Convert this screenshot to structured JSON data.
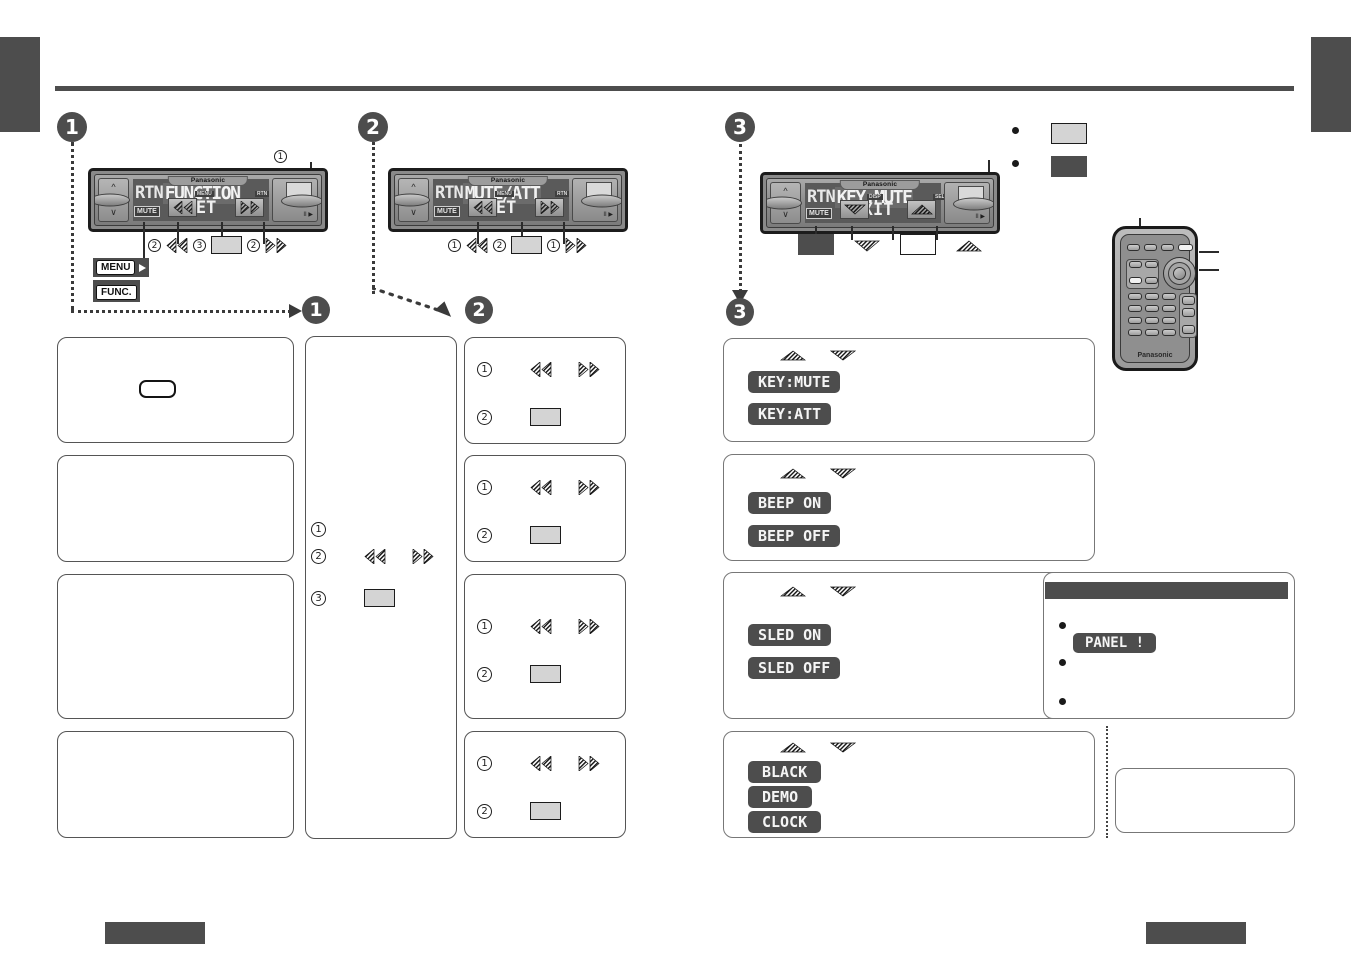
{
  "document": {
    "type": "car-audio-owners-manual-page",
    "title_rule": true
  },
  "edge_tabs": {
    "left": "",
    "right": ""
  },
  "footer": {
    "left_box": "",
    "right_box": ""
  },
  "steps": [
    {
      "number": "1"
    },
    {
      "number": "2"
    },
    {
      "number": "3"
    }
  ],
  "panel1": {
    "step_label": "1",
    "callout_top": "1",
    "stereo": {
      "brand": "Panasonic",
      "lcd_prefix": "RTN",
      "lcd_main": "FUNCTION",
      "lcd_bottom": "SET",
      "mute_badge": "MUTE",
      "tag_left": "MENU",
      "tag_right": "RTN",
      "play_pause": "II ▶"
    },
    "key_row": [
      {
        "num": "2",
        "icon": "chevron-left-hatched"
      },
      {
        "num": "3",
        "icon": "grey-key"
      },
      {
        "num": "2",
        "icon": "chevron-right-hatched"
      }
    ],
    "menu_label": "MENU",
    "func_label": "FUNC."
  },
  "panel2": {
    "step_label": "2",
    "stereo": {
      "brand": "Panasonic",
      "lcd_prefix": "RTN",
      "lcd_main": "MUTE/ATT",
      "lcd_bottom": "SET",
      "mute_badge": "MUTE",
      "tag_left": "MENU",
      "tag_right": "RTN",
      "play_pause": "II ▶"
    },
    "key_row": [
      {
        "num": "1",
        "icon": "chevron-left-hatched"
      },
      {
        "num": "2",
        "icon": "grey-key"
      },
      {
        "num": "1",
        "icon": "chevron-right-hatched"
      }
    ]
  },
  "panel3": {
    "step_label": "3",
    "stereo": {
      "brand": "Panasonic",
      "lcd_prefix": "RTN",
      "lcd_main": "KEY:MUTE",
      "lcd_bottom": "EXIT",
      "mute_badge": "MUTE",
      "tag_left": "DISP",
      "tag_right": "SEL",
      "play_pause": "II ▶"
    },
    "key_row": [
      {
        "icon": "dark-key"
      },
      {
        "icon": "triangle-down-hatched"
      },
      {
        "icon": "white-key"
      },
      {
        "icon": "triangle-up-hatched"
      }
    ],
    "legend": [
      {
        "bullet": true,
        "swatch": "light"
      },
      {
        "bullet": true,
        "swatch": "dark"
      }
    ]
  },
  "left_column_boxes": [
    {
      "id": "box-1",
      "content_icon": "rounded-white-key"
    },
    {
      "id": "box-2",
      "content_icon": null
    },
    {
      "id": "box-3",
      "content_icon": null
    },
    {
      "id": "box-4",
      "content_icon": null
    }
  ],
  "mid_column_box": {
    "rows": [
      {
        "num": "1"
      },
      {
        "num": "2",
        "icons": [
          "chevron-left-hatched",
          "chevron-right-hatched"
        ]
      },
      {
        "num": "3",
        "icons": [
          "grey-key"
        ]
      }
    ]
  },
  "mid_right_boxes": [
    {
      "rows": [
        {
          "num": "1",
          "icons": [
            "chevron-left-hatched",
            "chevron-right-hatched"
          ]
        },
        {
          "num": "2",
          "icons": [
            "grey-key"
          ]
        }
      ]
    },
    {
      "rows": [
        {
          "num": "1",
          "icons": [
            "chevron-left-hatched",
            "chevron-right-hatched"
          ]
        },
        {
          "num": "2",
          "icons": [
            "grey-key"
          ]
        }
      ]
    },
    {
      "rows": [
        {
          "num": "1",
          "icons": [
            "chevron-left-hatched",
            "chevron-right-hatched"
          ]
        },
        {
          "num": "2",
          "icons": [
            "grey-key"
          ]
        }
      ]
    },
    {
      "rows": [
        {
          "num": "1",
          "icons": [
            "chevron-left-hatched",
            "chevron-right-hatched"
          ]
        },
        {
          "num": "2",
          "icons": [
            "grey-key"
          ]
        }
      ]
    }
  ],
  "option_boxes": [
    {
      "id": "key-mute-box",
      "arrows": [
        "triangle-up-hatched",
        "triangle-down-hatched"
      ],
      "pills": [
        "KEY:MUTE",
        "KEY:ATT"
      ]
    },
    {
      "id": "beep-box",
      "arrows": [
        "triangle-up-hatched",
        "triangle-down-hatched"
      ],
      "pills": [
        "BEEP ON",
        "BEEP OFF"
      ]
    },
    {
      "id": "sled-box",
      "arrows": [
        "triangle-up-hatched",
        "triangle-down-hatched"
      ],
      "pills": [
        "SLED ON",
        "SLED OFF"
      ]
    },
    {
      "id": "display-mode-box",
      "arrows": [
        "triangle-up-hatched",
        "triangle-down-hatched"
      ],
      "pills": [
        "BLACK",
        "DEMO",
        "CLOCK"
      ]
    }
  ],
  "note_box": {
    "header_bar": "",
    "bullets": [
      "",
      "",
      ""
    ],
    "pill": "PANEL !"
  },
  "side_note_box": {
    "content": ""
  },
  "colors": {
    "ink": "#1a1a1a",
    "grey_dark": "#4d4d4d",
    "grey_mid": "#8a8a8a",
    "grey_light": "#d4d4d4",
    "lcd_bg": "#5a5a5a",
    "lcd_text": "#f2f2f2",
    "page_bg": "#ffffff"
  }
}
